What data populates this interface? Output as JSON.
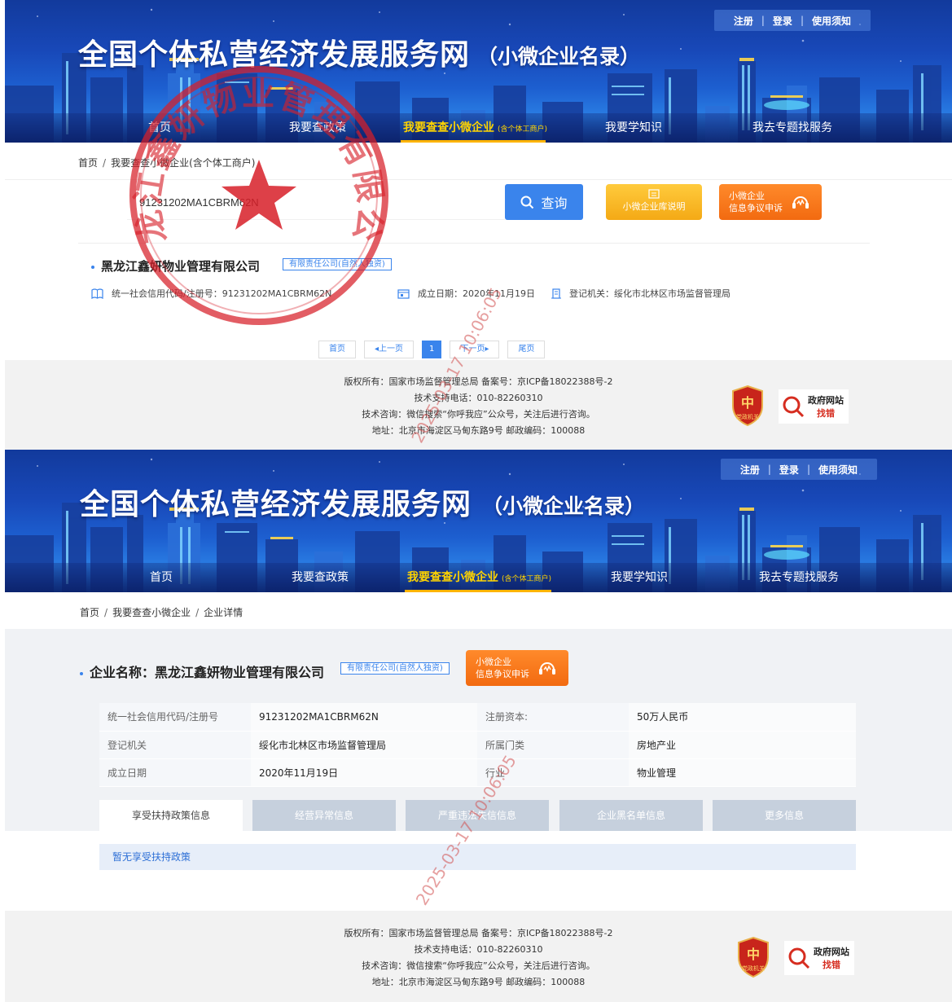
{
  "site": {
    "title": "全国个体私营经济发展服务网",
    "subtitle": "（小微企业名录）",
    "top_links": [
      "注册",
      "登录",
      "使用须知"
    ],
    "nav": [
      {
        "label": "首页"
      },
      {
        "label": "我要查政策"
      },
      {
        "label": "我要查查小微企业",
        "sub": "(含个体工商户)"
      },
      {
        "label": "我要学知识"
      },
      {
        "label": "我去专题找服务"
      }
    ]
  },
  "search_page": {
    "breadcrumb": [
      "首页",
      "我要查查小微企业(含个体工商户)"
    ],
    "search_value": "91231202MA1CBRM62N",
    "search_button": "查询",
    "guide_button": "小微企业库说明",
    "dispute_button": [
      "小微企业",
      "信息争议申诉"
    ],
    "result": {
      "name": "黑龙江鑫妍物业管理有限公司",
      "type_tag": "有限责任公司(自然人独资)",
      "credit_code_label": "统一社会信用代码/注册号：",
      "credit_code": "91231202MA1CBRM62N",
      "established_label": "成立日期：",
      "established": "2020年11月19日",
      "authority_label": "登记机关：",
      "authority": "绥化市北林区市场监督管理局"
    },
    "pager": {
      "first": "首页",
      "prev": "上一页",
      "current": "1",
      "next": "下一页",
      "last": "尾页"
    }
  },
  "footer": {
    "copyright": "版权所有：国家市场监督管理总局 备案号：京ICP备18022388号-2",
    "phone": "技术支持电话：010-82260310",
    "consult": "技术咨询：微信搜索“你呼我应”公众号，关注后进行咨询。",
    "address": "地址：北京市海淀区马甸东路9号 邮政编码：100088",
    "badge_shield": "党政机关",
    "badge_gov": [
      "政府网站",
      "找错"
    ]
  },
  "detail_page": {
    "breadcrumb": [
      "首页",
      "我要查查小微企业",
      "企业详情"
    ],
    "name_label": "企业名称：",
    "name": "黑龙江鑫妍物业管理有限公司",
    "type_tag": "有限责任公司(自然人独资)",
    "rows": [
      {
        "k1": "统一社会信用代码/注册号",
        "v1": "91231202MA1CBRM62N",
        "k2": "注册资本:",
        "v2": "50万人民币"
      },
      {
        "k1": "登记机关",
        "v1": "绥化市北林区市场监督管理局",
        "k2": "所属门类",
        "v2": "房地产业"
      },
      {
        "k1": "成立日期",
        "v1": "2020年11月19日",
        "k2": "行业",
        "v2": "物业管理"
      }
    ],
    "tabs": [
      "享受扶持政策信息",
      "经营异常信息",
      "严重违法失信信息",
      "企业黑名单信息",
      "更多信息"
    ],
    "empty_text": "暂无享受扶持政策"
  },
  "watermark": {
    "seal_text": "黑龙江鑫妍物业管理有限公司",
    "timestamp": "2025-03-17 10:06:05"
  }
}
